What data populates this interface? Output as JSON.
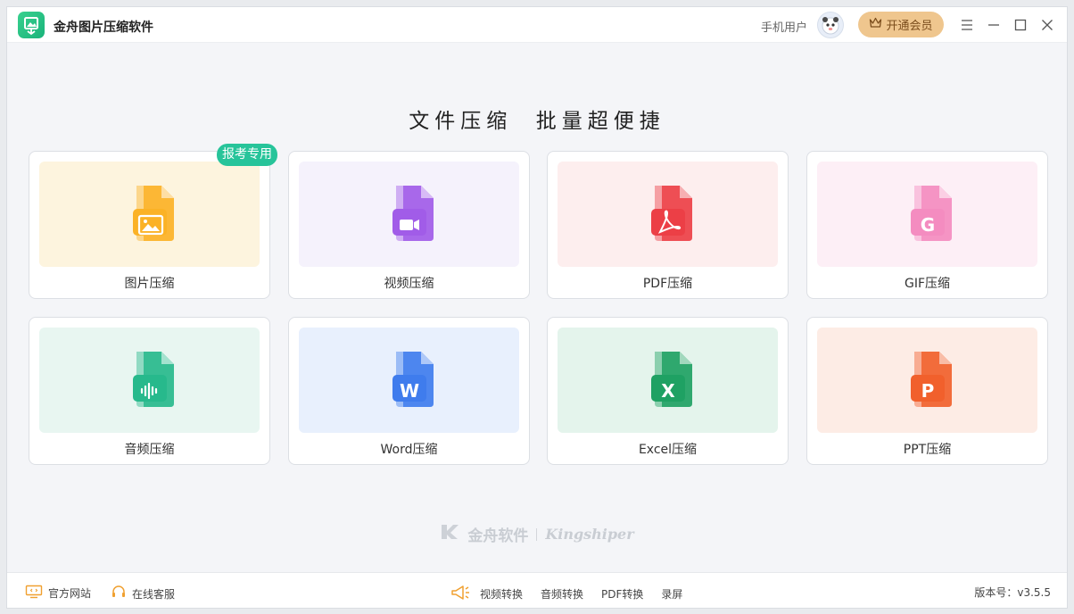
{
  "app": {
    "title": "金舟图片压缩软件"
  },
  "header": {
    "user_name": "手机用户",
    "vip_label": "开通会员"
  },
  "main": {
    "headline": "文件压缩  批量超便捷",
    "cards": [
      {
        "label": "图片压缩",
        "badge": "报考专用",
        "icon": "image-file-icon",
        "bg": "#fdf4de",
        "color": "#fbb226",
        "glyph": "image"
      },
      {
        "label": "视频压缩",
        "icon": "video-file-icon",
        "bg": "#f5f2fc",
        "color": "#a15ce8",
        "glyph": "video"
      },
      {
        "label": "PDF压缩",
        "icon": "pdf-file-icon",
        "bg": "#fdeeee",
        "color": "#ec3f46",
        "glyph": "pdf"
      },
      {
        "label": "GIF压缩",
        "icon": "gif-file-icon",
        "bg": "#fdeff6",
        "color": "#f48cc0",
        "glyph": "G"
      },
      {
        "label": "音频压缩",
        "icon": "audio-file-icon",
        "bg": "#e8f6f1",
        "color": "#27b98c",
        "glyph": "audio"
      },
      {
        "label": "Word压缩",
        "icon": "word-file-icon",
        "bg": "#e8f0fd",
        "color": "#3f7ced",
        "glyph": "W"
      },
      {
        "label": "Excel压缩",
        "icon": "excel-file-icon",
        "bg": "#e4f4ec",
        "color": "#1fa163",
        "glyph": "X"
      },
      {
        "label": "PPT压缩",
        "icon": "ppt-file-icon",
        "bg": "#fdece5",
        "color": "#f1602c",
        "glyph": "P"
      }
    ]
  },
  "watermark": {
    "cn": "金舟软件",
    "en": "Kingshiper"
  },
  "footer": {
    "website": "官方网站",
    "support": "在线客服",
    "tools": [
      "视频转换",
      "音频转换",
      "PDF转换",
      "录屏"
    ],
    "version": "版本号：v3.5.5"
  }
}
